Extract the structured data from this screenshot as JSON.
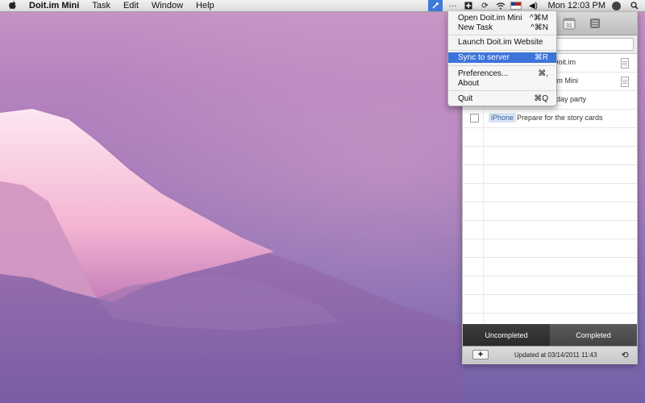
{
  "menubar": {
    "apple": "",
    "app_name": "Doit.im Mini",
    "menus": [
      "Task",
      "Edit",
      "Window",
      "Help"
    ],
    "clock": "Mon 12:03 PM",
    "extras_icons": [
      "doit-menu-icon",
      "dots-icon",
      "plus-square-icon",
      "sync-icon",
      "wifi-icon",
      "flag-icon",
      "volume-icon",
      "user-icon",
      "spotlight-icon"
    ]
  },
  "dropdown": {
    "items": [
      {
        "label": "Open Doit.im Mini",
        "shortcut": "^⌘M"
      },
      {
        "label": "New Task",
        "shortcut": "^⌘N"
      },
      {
        "label": "Launch Doit.im Website",
        "shortcut": ""
      },
      {
        "label": "Sync to server",
        "shortcut": "⌘R",
        "highlighted": true
      },
      {
        "label": "Preferences...",
        "shortcut": "⌘,"
      },
      {
        "label": "About",
        "shortcut": ""
      },
      {
        "label": "Quit",
        "shortcut": "⌘Q"
      }
    ]
  },
  "panel": {
    "tasks": [
      {
        "tag": "",
        "title": "Doit.im",
        "has_note": true
      },
      {
        "tag": "",
        "title": ".im Mini",
        "has_note": true
      },
      {
        "tag": "",
        "title": "day party",
        "has_note": false
      },
      {
        "tag": "iPhone",
        "title": "Prepare for the story cards",
        "has_note": false
      }
    ],
    "tabs": [
      "Uncompleted",
      "Completed"
    ],
    "add_label": "+",
    "updated_text": "Updated at 03/14/2011 11:43",
    "search_placeholder": ""
  },
  "colors": {
    "highlight": "#3d74d9",
    "tab_selected": "#2b2b2b",
    "tab_unselected": "#4c4c4c"
  }
}
